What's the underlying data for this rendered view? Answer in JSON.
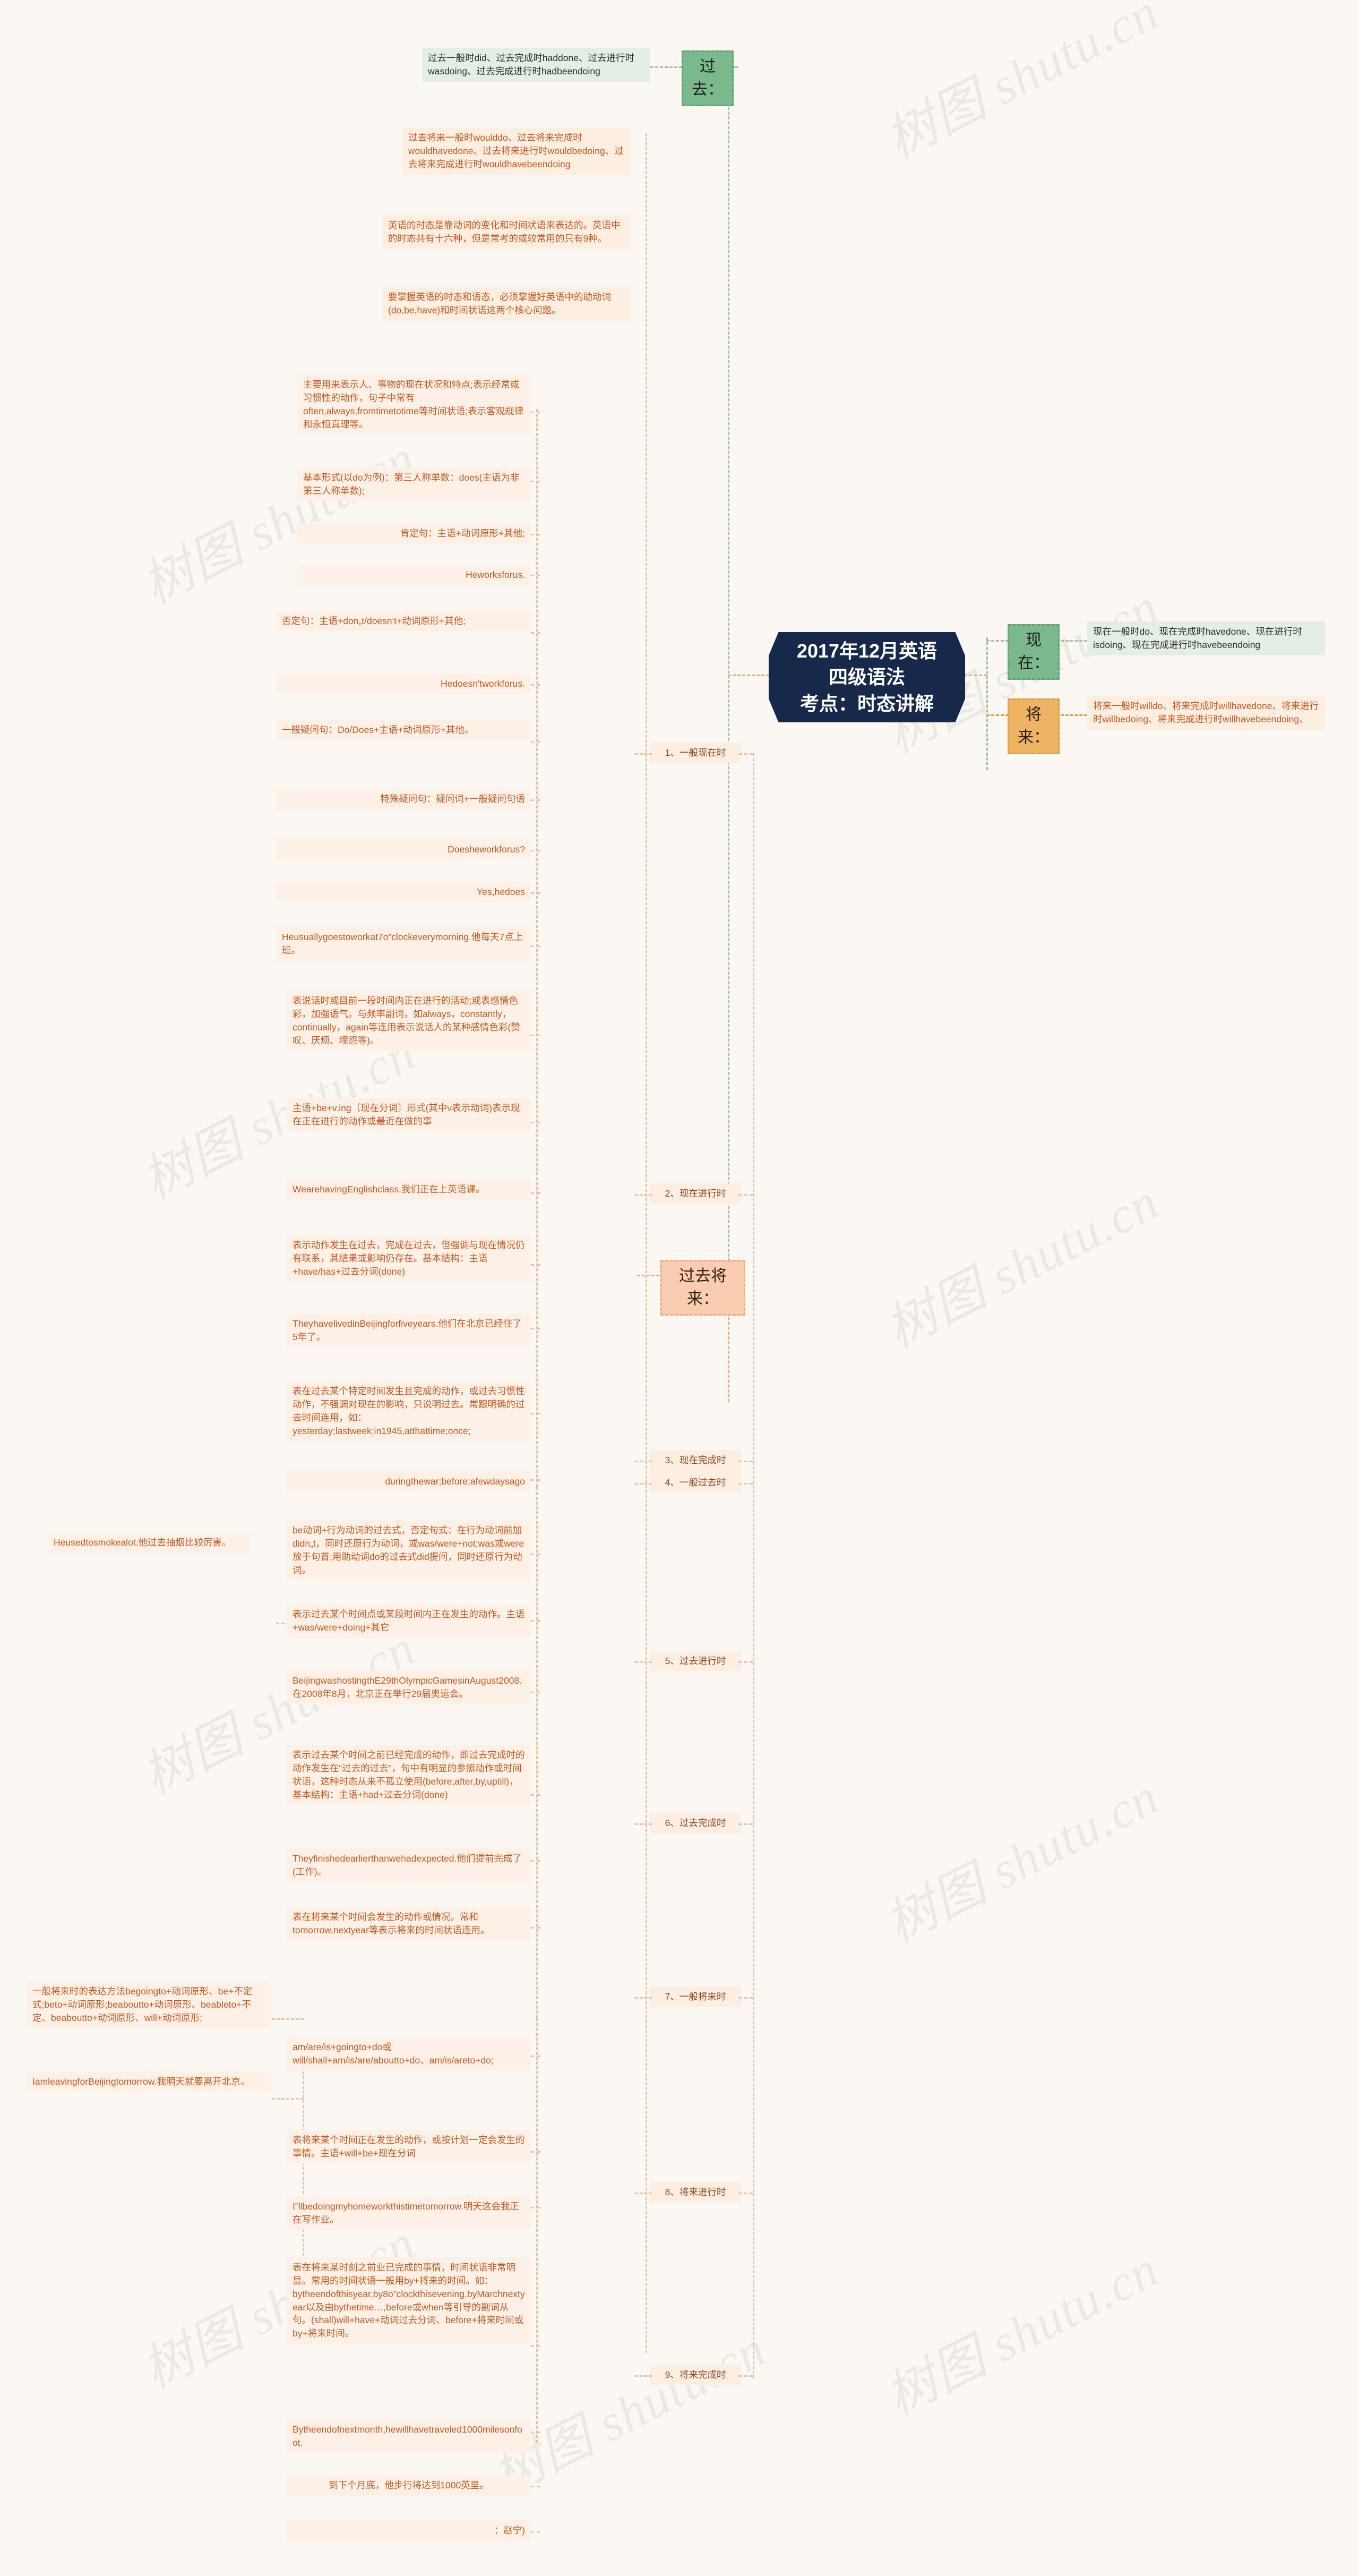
{
  "central": {
    "line1": "2017年12月英语四级语法",
    "line2": "考点：时态讲解"
  },
  "branches": {
    "past_label": "过去：",
    "present_label": "现在：",
    "future_label": "将来：",
    "past_future_label": "过去将来："
  },
  "tense_cards": {
    "past": "过去一般时did、过去完成时haddone、过去进行时wasdoing、过去完成进行时hadbeendoing",
    "past_future": "过去将来一般时woulddo、过去将来完成时wouldhavedone、过去将来进行时wouldbedoing、过去将来完成进行时wouldhavebeendoing",
    "present": "现在一般时do、现在完成时havedone、现在进行时isdoing、现在完成进行时havebeendoing",
    "future": "将来一般时willdo、将来完成时willhavedone、将来进行时willbedoing、将来完成进行时willhavebeendoing、"
  },
  "intro_notes": [
    "英语的时态是靠动词的变化和时间状语来表达的。英语中的时态共有十六种，但是常考的或较常用的只有9种。",
    "要掌握英语的时态和语态，必须掌握好英语中的助动词(do,be,have)和时间状语这两个核心问题。"
  ],
  "categories": {
    "c1": "1、一般现在时",
    "c2": "2、现在进行时",
    "c3": "3、现在完成时",
    "c4": "4、一般过去时",
    "c5": "5、过去进行时",
    "c6": "6、过去完成时",
    "c7": "7、一般将来时",
    "c8": "8、将来进行时",
    "c9": "9、将来完成时"
  },
  "items": {
    "p1_usage": "主要用来表示人、事物的现在状况和特点;表示经常或习惯性的动作，句子中常有often,always,fromtimetotime等时间状语;表示客观规律和永恒真理等。",
    "p1_form": "基本形式(以do为例)：第三人称单数：does(主语为非第三人称单数);",
    "p1_affirm": "肯定句：主语+动词原形+其他;",
    "p1_affirm_ex": "Heworksforus.",
    "p1_negate": "否定句：主语+don„t/doesn't+动词原形+其他;",
    "p1_negate_ex": "Hedoesn'tworkforus.",
    "p1_question": "一般疑问句：Do/Does+主语+动词原形+其他。",
    "p1_special": "特殊疑问句：疑问词+一般疑问句语",
    "p1_special_ex": "Doesheworkforus?",
    "p1_answer": "Yes,hedoes",
    "p1_example": "Heusuallygoestoworkat7o‟clockeverymorning.他每天7点上班。",
    "p2_usage": "表说话时或目前一段时间内正在进行的活动;或表感情色彩，加强语气。与频率副词，如always，constantly，continually，again等连用表示说话人的某种感情色彩(赞叹、厌烦、埋怨等)。",
    "p2_form": "主语+be+v.ing〔现在分词〕形式(其中v表示动词)表示现在正在进行的动作或最近在做的事",
    "p2_example": "WearehavingEnglishclass.我们正在上英语课。",
    "p3_usage": "表示动作发生在过去，完成在过去，但强调与现在情况仍有联系，其结果或影响仍存在。基本结构：主语+have/has+过去分词(done)",
    "p3_example": "TheyhavelivedinBeijingforfiveyears.他们在北京已经住了5年了。",
    "p4_usage": "表在过去某个特定时间发生且完成的动作，或过去习惯性动作，不强调对现在的影响，只说明过去。常跟明确的过去时间连用，如：yesterday;lastweek;in1945,atthattime;once;",
    "p4_adverbs": "duringthewar;before;afewdaysago",
    "p4_form": "be动词+行为动词的过去式，否定句式：在行为动词前加didn„t，同时还原行为动词，或was/were+not;was或were放于句首;用助动词do的过去式did提问，同时还原行为动词。",
    "p4_example": "Heusedtosmokealot.他过去抽烟比较厉害。",
    "p5_usage": "表示过去某个时间点或某段时间内正在发生的动作。主语+was/were+doing+其它",
    "p5_example": "BeijingwashostingthE29thOlympicGamesinAugust2008.在2008年8月，北京正在举行29届奥运会。",
    "p6_usage": "表示过去某个时间之前已经完成的动作，即过去完成时的动作发生在“过去的过去”，句中有明显的参照动作或时间状语，这种时态从来不孤立使用(before,after,by,uptill)，基本结构：主语+had+过去分词(done)",
    "p6_example": "Theyfinishedearlierthanwehadexpected.他们提前完成了(工作)。",
    "p7_usage": "表在将来某个时间会发生的动作或情况。常和tomorrow,nextyear等表示将来的时间状语连用。",
    "p7_methods": "一般将来时的表达方法begoingto+动词原形、be+不定式;beto+动词原形;beaboutto+动词原形、beableto+不定、beaboutto+动词原形、will+动词原形;",
    "p7_form": "am/are/is+goingto+do或will/shall+am/is/are/aboutto+do、am/is/areto+do;",
    "p7_example": "IamleavingforBeijingtomorrow.我明天就要离开北京。",
    "p8_usage": "表将来某个时间正在发生的动作，或按计划一定会发生的事情。主语+will+be+现在分词",
    "p8_example": "I‟llbedoingmyhomeworkthistimetomorrow.明天这会我正在写作业。",
    "p9_usage": "表在将来某时刻之前业已完成的事情，时间状语非常明显。常用的时间状语一般用by+将来的时间。如：bytheendofthisyear,by8o‟clockthisevening,byMarchnextyear以及由bythetime…,before或when等引导的副词从句。(shall)will+have+动词过去分词、before+将来时间或by+将来时间。",
    "p9_example": "Bytheendofnextmonth,hewillhavetraveled1000milesonfoot.",
    "p9_translation": "到下个月底，他步行将达到1000英里。",
    "p9_author": "：赵宁)"
  },
  "watermarks": [
    "树图 shutu.cn",
    "树图 shutu.cn",
    "树图 shutu.cn",
    "树图 shutu.cn",
    "树图 shutu.cn",
    "树图 shutu.cn",
    "树图 shutu.cn",
    "树图 shutu.cn",
    "树图 shutu.cn",
    "树图 shutu.cn"
  ],
  "colors": {
    "central_bg": "#16294a",
    "green_accent": "#7bb98c",
    "amber_accent": "#eeb464",
    "salmon_accent": "#fbcdb0",
    "mint_bg": "#e3eee5",
    "peach_bg": "#fdeee2",
    "text_orange": "#c1581e",
    "page_bg": "#fbf8f4"
  }
}
